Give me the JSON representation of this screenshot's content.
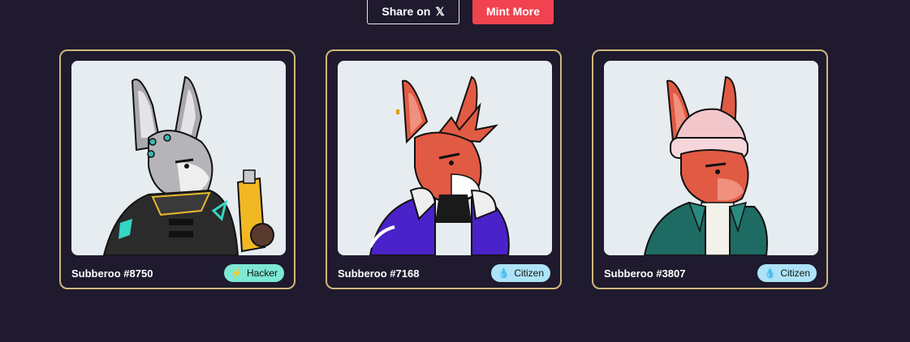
{
  "actions": {
    "share_label": "Share on",
    "share_glyph": "𝕏",
    "mint_label": "Mint More"
  },
  "cards": [
    {
      "name": "Subberoo #8750",
      "badge_label": "Hacker",
      "badge_icon": "lightning-icon",
      "badge_glyph": "⚡",
      "badge_color": "#7de8d4",
      "character": "grey-rabbit-cyber-hacker"
    },
    {
      "name": "Subberoo #7168",
      "badge_label": "Citizen",
      "badge_icon": "water-drop-icon",
      "badge_glyph": "💧",
      "badge_color": "#aee3f7",
      "character": "red-kangaroo-purple-jacket"
    },
    {
      "name": "Subberoo #3807",
      "badge_label": "Citizen",
      "badge_icon": "water-drop-icon",
      "badge_glyph": "💧",
      "badge_color": "#aee3f7",
      "character": "red-kangaroo-pink-beanie"
    }
  ],
  "colors": {
    "background": "#1f1a2e",
    "card_border": "#cfb77b",
    "mint_button": "#f0424f"
  }
}
